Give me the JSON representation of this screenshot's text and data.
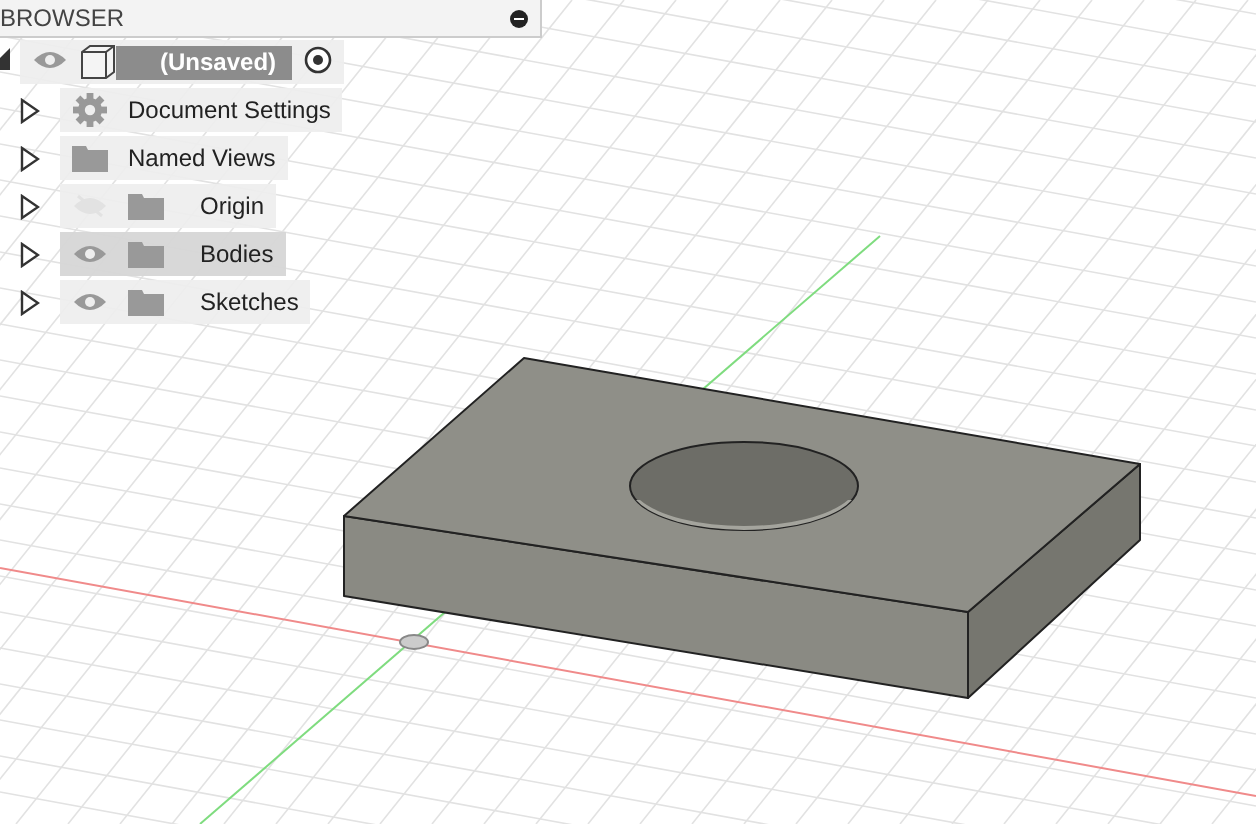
{
  "browser": {
    "title": "BROWSER",
    "root": {
      "label": "(Unsaved)",
      "expanded": true,
      "visible": true,
      "active": true,
      "children": [
        {
          "kind": "settings",
          "label": "Document Settings",
          "expanded": false,
          "selected": false
        },
        {
          "kind": "views",
          "label": "Named Views",
          "expanded": false,
          "selected": false
        },
        {
          "kind": "folder",
          "label": "Origin",
          "expanded": false,
          "visible": false,
          "selected": false
        },
        {
          "kind": "folder",
          "label": "Bodies",
          "expanded": false,
          "visible": true,
          "selected": true
        },
        {
          "kind": "folder",
          "label": "Sketches",
          "expanded": false,
          "visible": true,
          "selected": false
        }
      ]
    }
  }
}
